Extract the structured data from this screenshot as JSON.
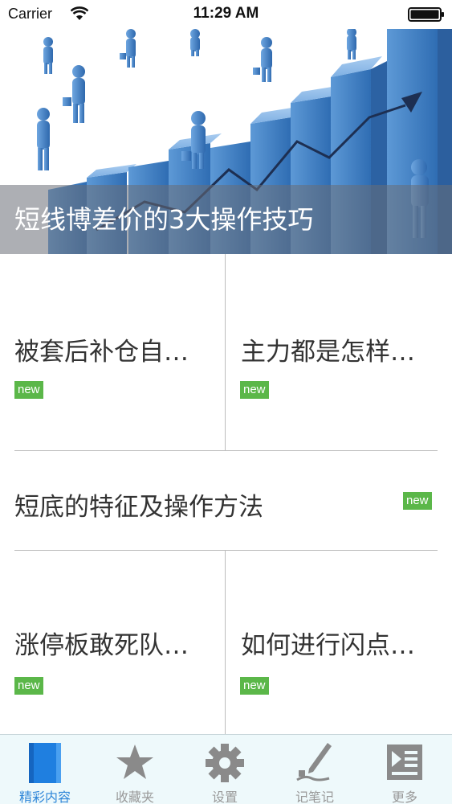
{
  "status_bar": {
    "carrier": "Carrier",
    "time": "11:29 AM"
  },
  "hero": {
    "title": "短线博差价的3大操作技巧"
  },
  "articles": [
    {
      "title": "被套后补仓自…",
      "badge": "new"
    },
    {
      "title": "主力都是怎样…",
      "badge": "new"
    },
    {
      "title": "短底的特征及操作方法",
      "badge": "new"
    },
    {
      "title": "涨停板敢死队…",
      "badge": "new"
    },
    {
      "title": "如何进行闪点…",
      "badge": "new"
    }
  ],
  "tabbar": {
    "tabs": [
      {
        "label": "精彩内容",
        "icon": "book-icon",
        "active": true
      },
      {
        "label": "收藏夹",
        "icon": "star-icon",
        "active": false
      },
      {
        "label": "设置",
        "icon": "gear-icon",
        "active": false
      },
      {
        "label": "记笔记",
        "icon": "pen-icon",
        "active": false
      },
      {
        "label": "更多",
        "icon": "more-list-icon",
        "active": false
      }
    ]
  },
  "colors": {
    "badge_green": "#5bb749",
    "active_tab": "#2f86d8",
    "inactive_tab": "#999999",
    "chart_blue": "#3f7fc4"
  }
}
